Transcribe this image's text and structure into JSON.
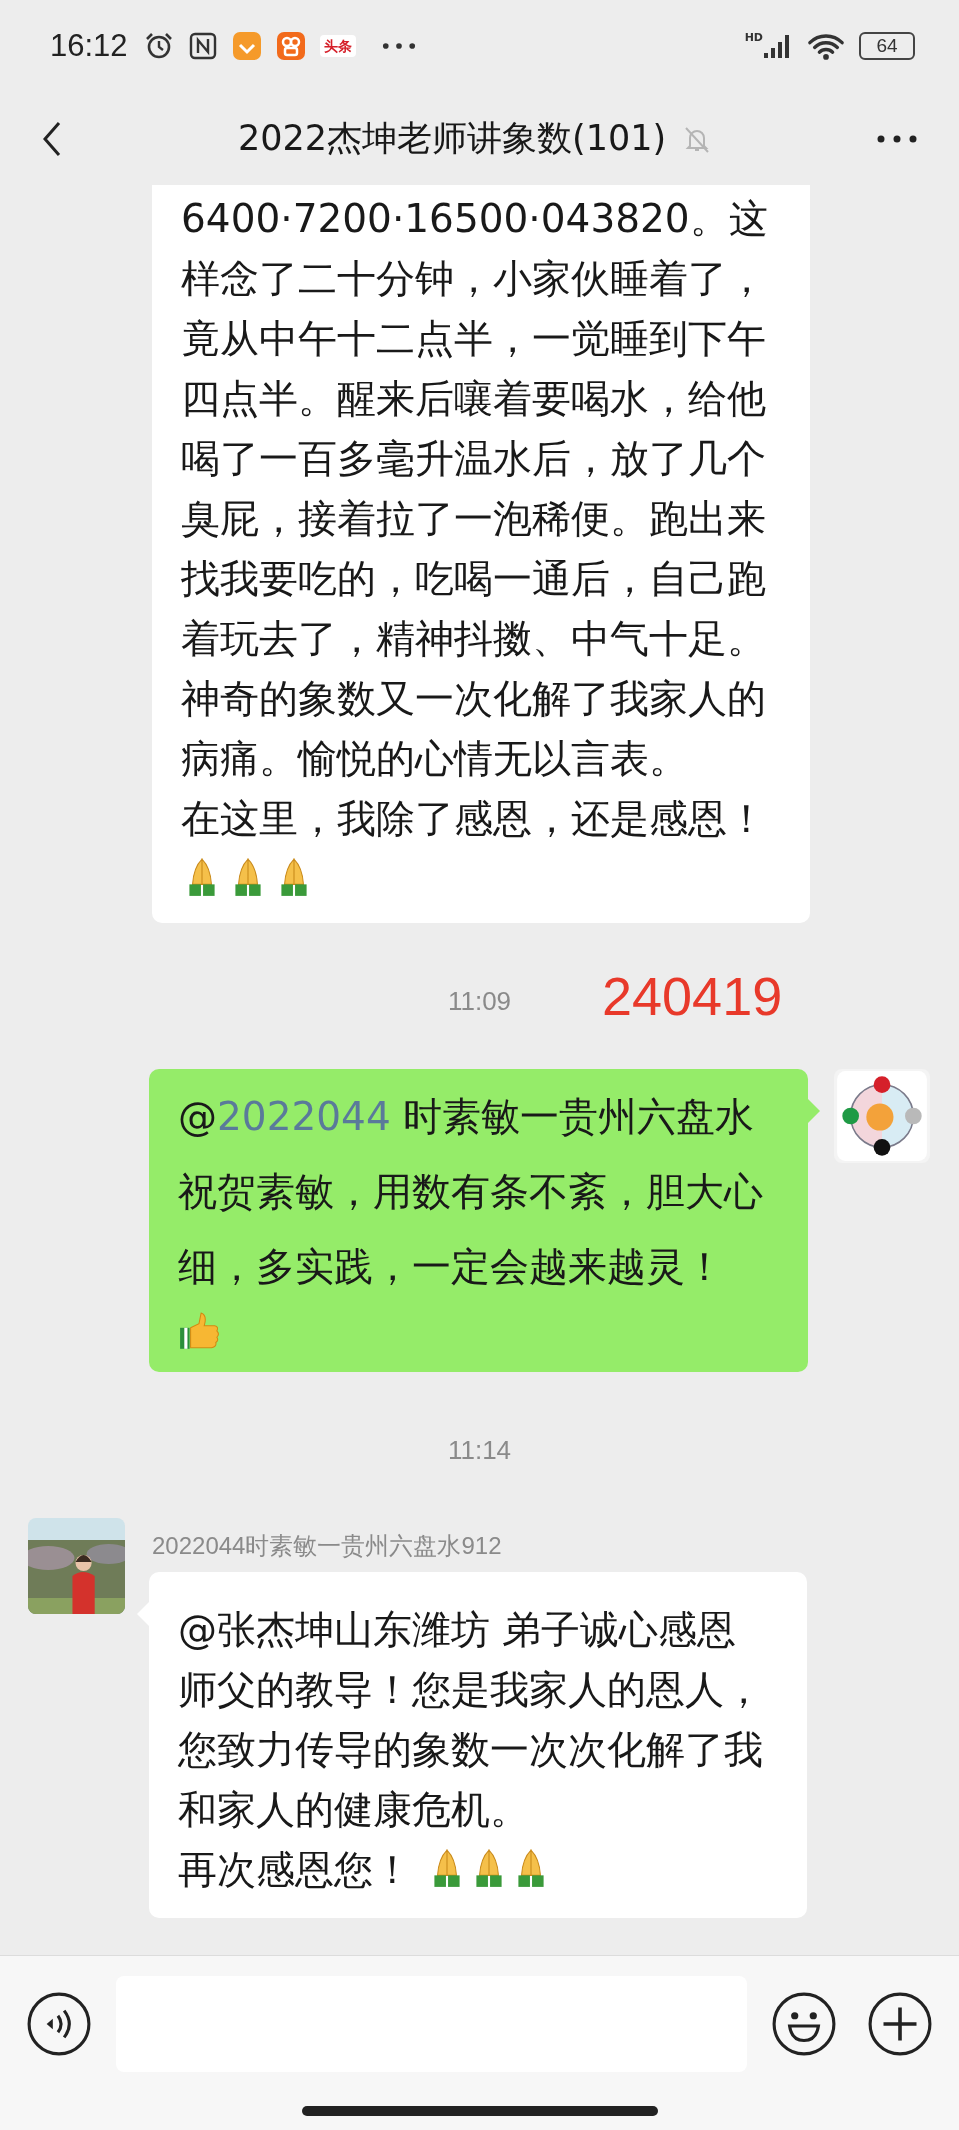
{
  "status_bar": {
    "time": "16:12",
    "app_badge": "头条",
    "network": "HD",
    "battery": "64"
  },
  "header": {
    "title": "2022杰坤老师讲象数(101)",
    "muted": true
  },
  "messages": [
    {
      "kind": "text",
      "mine": false,
      "lines": [
        "6400·7200·16500·043820。这",
        "样念了二十分钟，小家伙睡着了，",
        "竟从中午十二点半，一觉睡到下午",
        "四点半。醒来后嚷着要喝水，给他",
        "喝了一百多毫升温水后，放了几个",
        "臭屁，接着拉了一泡稀便。跑出来",
        "找我要吃的，吃喝一通后，自己跑",
        "着玩去了，精神抖擞、中气十足。",
        "神奇的象数又一次化解了我家人的",
        "病痛。愉悦的心情无以言表。",
        "在这里，我除了感恩，还是感恩！"
      ],
      "emoji": [
        {
          "kind": "pray"
        },
        {
          "kind": "pray"
        },
        {
          "kind": "pray"
        }
      ]
    },
    {
      "kind": "time",
      "time": "11:09",
      "note": "240419"
    },
    {
      "kind": "text",
      "mine": true,
      "at": "@",
      "mention": "2022044",
      "lines": [
        " 时素敏一贵州六盘水",
        "祝贺素敏，用数有条不紊，胆大心",
        "细，多实践，一定会越来越灵！"
      ],
      "emoji": [
        {
          "kind": "thumbs_up"
        }
      ]
    },
    {
      "kind": "time",
      "time": "11:14"
    },
    {
      "kind": "text",
      "mine": false,
      "sender": "2022044时素敏一贵州六盘水912",
      "lines": [
        "@张杰坤山东潍坊  弟子诚心感恩",
        "师父的教导！您是我家人的恩人，",
        "您致力传导的象数一次次化解了我",
        "和家人的健康危机。",
        "再次感恩您！"
      ],
      "emoji": [
        {
          "kind": "pray"
        },
        {
          "kind": "pray"
        },
        {
          "kind": "pray"
        }
      ],
      "emoji_inline": true
    }
  ]
}
